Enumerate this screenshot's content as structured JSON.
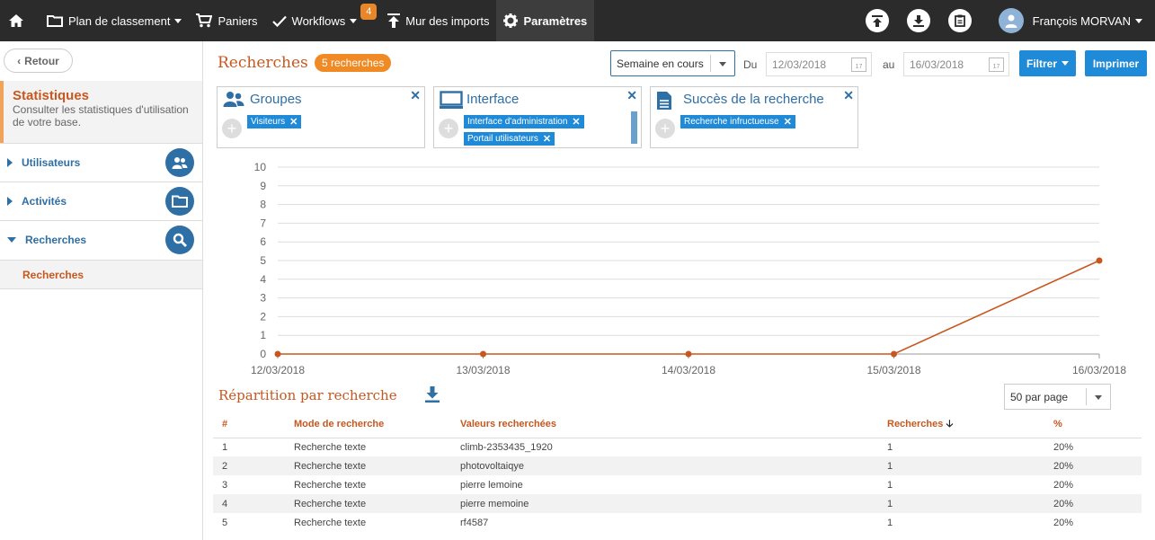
{
  "topbar": {
    "items": [
      {
        "label": "Plan de classement",
        "icon": "folder-icon"
      },
      {
        "label": "Paniers",
        "icon": "cart-icon"
      },
      {
        "label": "Workflows",
        "icon": "check-icon",
        "badge": "4"
      },
      {
        "label": "Mur des imports",
        "icon": "upload-icon"
      },
      {
        "label": "Paramètres",
        "icon": "gear-icon"
      }
    ],
    "user": "François MORVAN"
  },
  "sidebar": {
    "back": "Retour",
    "stats_title": "Statistiques",
    "stats_sub": "Consulter les statistiques d'utilisation de votre base.",
    "items": [
      {
        "label": "Utilisateurs"
      },
      {
        "label": "Activités"
      },
      {
        "label": "Recherches"
      }
    ],
    "sub_item": "Recherches"
  },
  "main": {
    "title": "Recherches",
    "count": "5 recherches",
    "period": "Semaine en cours",
    "du": "Du",
    "date_from": "12/03/2018",
    "au": "au",
    "date_to": "16/03/2018",
    "filter_btn": "Filtrer",
    "print_btn": "Imprimer",
    "cards": [
      {
        "title": "Groupes",
        "tags": [
          "Visiteurs"
        ]
      },
      {
        "title": "Interface",
        "tags": [
          "Interface d'administration",
          "Portail utilisateurs"
        ]
      },
      {
        "title": "Succès de la recherche",
        "tags": [
          "Recherche infructueuse"
        ]
      }
    ],
    "section_title": "Répartition par recherche",
    "per_page": "50 par page",
    "table": {
      "headers": [
        "#",
        "Mode de recherche",
        "Valeurs recherchées",
        "Recherches",
        "%"
      ],
      "rows": [
        [
          "1",
          "Recherche texte",
          "climb-2353435_1920",
          "1",
          "20%"
        ],
        [
          "2",
          "Recherche texte",
          "photovoltaiqye",
          "1",
          "20%"
        ],
        [
          "3",
          "Recherche texte",
          "pierre lemoine",
          "1",
          "20%"
        ],
        [
          "4",
          "Recherche texte",
          "pierre memoine",
          "1",
          "20%"
        ],
        [
          "5",
          "Recherche texte",
          "rf4587",
          "1",
          "20%"
        ]
      ]
    }
  },
  "chart_data": {
    "type": "line",
    "categories": [
      "12/03/2018",
      "13/03/2018",
      "14/03/2018",
      "15/03/2018",
      "16/03/2018"
    ],
    "values": [
      0,
      0,
      0,
      0,
      5
    ],
    "ylim": [
      0,
      10
    ],
    "yticks": [
      "0",
      "1",
      "2",
      "3",
      "4",
      "5",
      "6",
      "7",
      "8",
      "9",
      "10"
    ],
    "color": "#c8571f",
    "grid": true
  }
}
